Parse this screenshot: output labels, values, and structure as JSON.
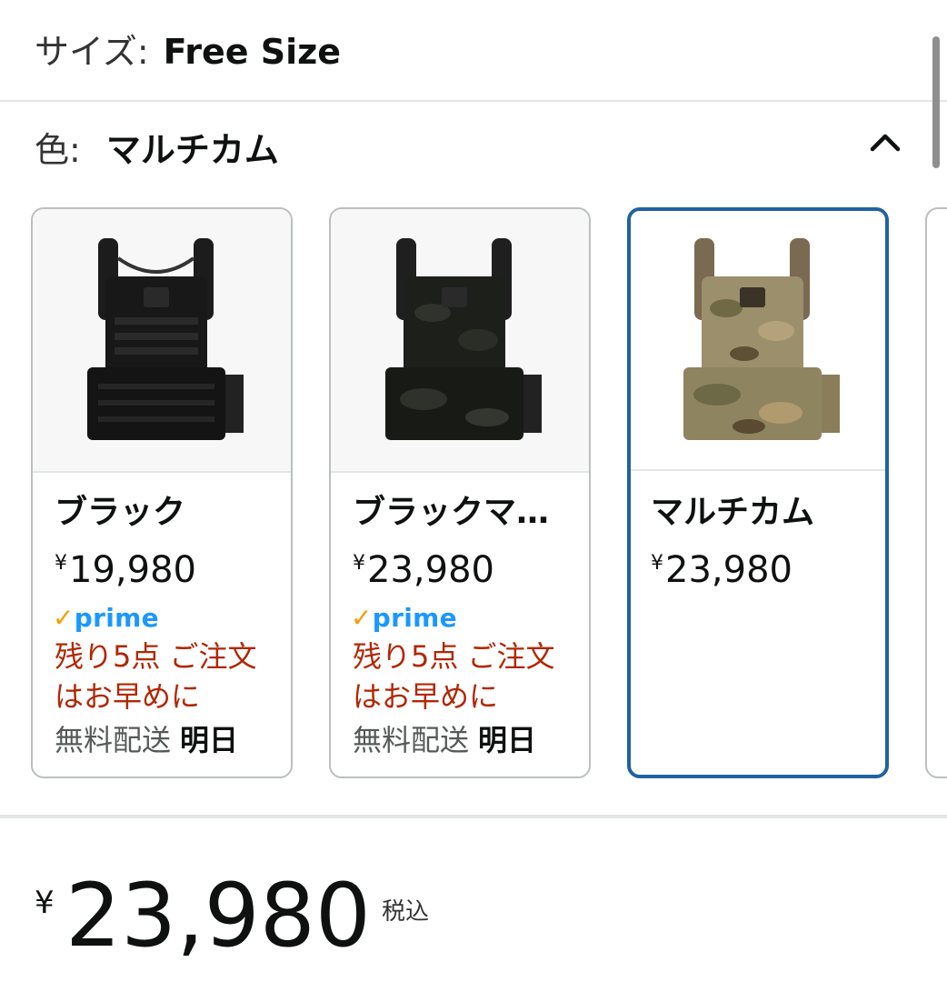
{
  "size": {
    "label": "サイズ:",
    "value": "Free Size"
  },
  "color": {
    "label": "色:",
    "value": "マルチカム",
    "collapse_icon": "chevron-up-icon"
  },
  "variants": [
    {
      "name": "ブラック",
      "currency": "¥",
      "price": "19,980",
      "prime": "prime",
      "stock": "残り5点 ご注文はお早めに",
      "ship_label": "無料配送",
      "ship_day": "明日",
      "selected": false
    },
    {
      "name": "ブラックマ…",
      "currency": "¥",
      "price": "23,980",
      "prime": "prime",
      "stock": "残り5点 ご注文はお早めに",
      "ship_label": "無料配送",
      "ship_day": "明日",
      "selected": false
    },
    {
      "name": "マルチカム",
      "currency": "¥",
      "price": "23,980",
      "selected": true
    }
  ],
  "total": {
    "currency": "¥",
    "amount": "23,980",
    "tax_label": "税込"
  },
  "colors": {
    "selected_border": "#2162a1",
    "prime_blue": "#1a98ff",
    "prime_check": "#f49e00",
    "stock_red": "#b12704"
  }
}
